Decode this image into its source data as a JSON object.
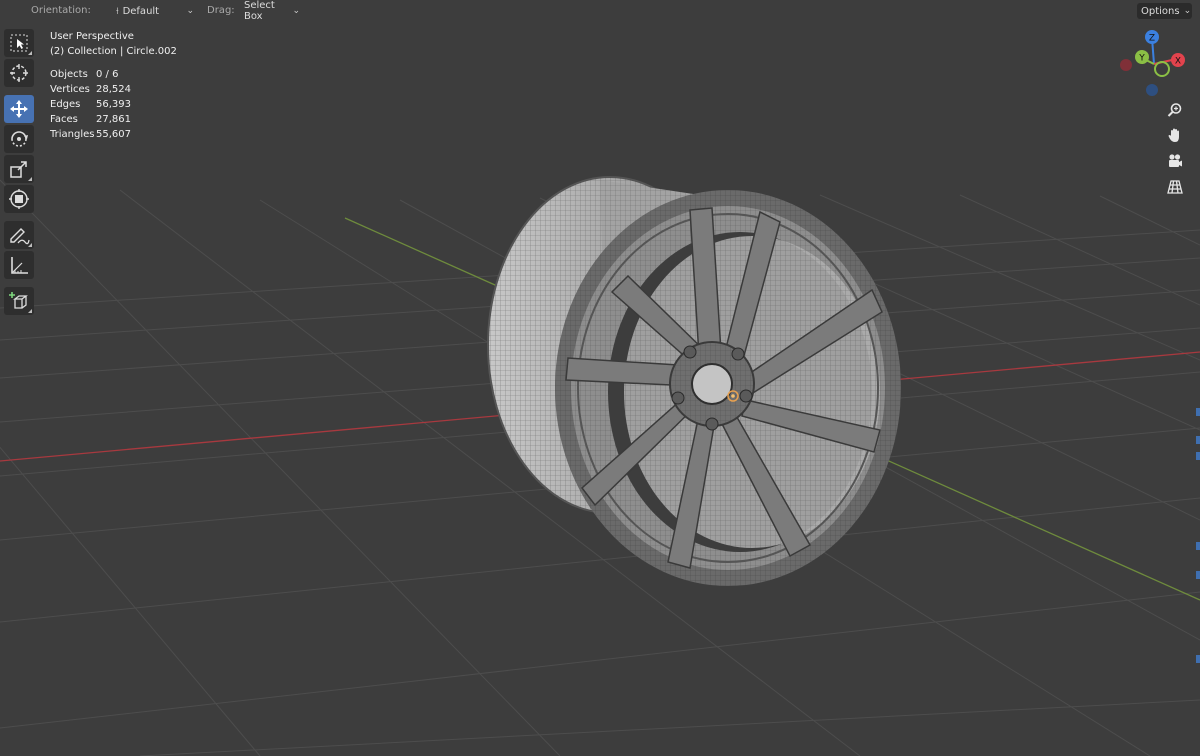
{
  "header": {
    "orientation_label": "Orientation:",
    "orientation_value": "Default",
    "drag_label": "Drag:",
    "drag_value": "Select Box",
    "options_label": "Options"
  },
  "toolbar": {
    "tools": [
      {
        "icon": "select-box-icon",
        "active": false
      },
      {
        "icon": "cursor-icon",
        "active": false
      },
      {
        "icon": "move-icon",
        "active": true
      },
      {
        "icon": "rotate-icon",
        "active": false
      },
      {
        "icon": "scale-icon",
        "active": false
      },
      {
        "icon": "transform-icon",
        "active": false
      },
      {
        "icon": "annotate-icon",
        "active": false
      },
      {
        "icon": "measure-icon",
        "active": false
      },
      {
        "icon": "add-cube-icon",
        "active": false
      }
    ]
  },
  "overlay": {
    "view_name": "User Perspective",
    "collection": "(2) Collection | Circle.002",
    "stats": [
      {
        "label": "Objects",
        "value": "0 / 6"
      },
      {
        "label": "Vertices",
        "value": "28,524"
      },
      {
        "label": "Edges",
        "value": "56,393"
      },
      {
        "label": "Faces",
        "value": "27,861"
      },
      {
        "label": "Triangles",
        "value": "55,607"
      }
    ]
  },
  "gizmo": {
    "axis_z": "Z",
    "axis_y": "Y",
    "axis_x": "X",
    "colors": {
      "x": "#e2434d",
      "y": "#8bbf45",
      "z": "#3b80e0"
    }
  },
  "nav": [
    "zoom-icon",
    "hand-pan-icon",
    "camera-icon",
    "grid-view-icon"
  ],
  "colors": {
    "background": "#3d3d3d",
    "active_tool": "#4772b3",
    "grid": "#4b4b4b",
    "x_axis": "#a8393f",
    "y_axis": "#6e8b3d"
  }
}
